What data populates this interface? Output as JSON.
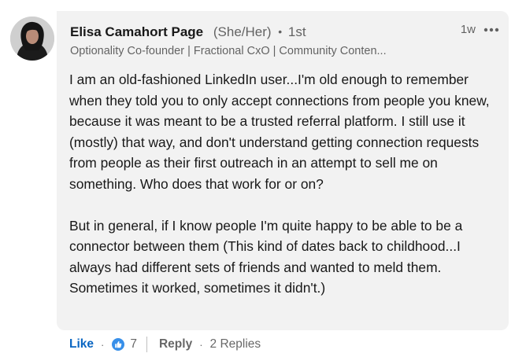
{
  "comment": {
    "author": {
      "name": "Elisa Camahort Page",
      "pronouns": "(She/Her)",
      "separator": "•",
      "degree": "1st",
      "headline": "Optionality Co-founder | Fractional CxO | Community Conten..."
    },
    "timestamp": "1w",
    "more_icon": "ellipsis-icon",
    "paragraphs": [
      "I am an old-fashioned LinkedIn user...I'm old enough to remember when they told you to only accept connections from people you knew, because it was meant to be a trusted referral platform. I still use it (mostly) that way, and don't understand getting connection requests from people as their first outreach in an attempt to sell me on something. Who does that work for or on?",
      "But in general, if I know people I'm quite happy to be able to be a connector between them (This kind of dates back to childhood...I always had different sets of friends and wanted to meld them. Sometimes it worked, sometimes it didn't.)"
    ]
  },
  "actions": {
    "like_label": "Like",
    "dot": "·",
    "reaction_icon": "thumbs-up-icon",
    "reaction_count": "7",
    "reply_label": "Reply",
    "replies_label": "2 Replies"
  },
  "colors": {
    "like_blue": "#0a66c2",
    "reaction_blue": "#378fe9",
    "bubble_bg": "#f2f2f2"
  }
}
